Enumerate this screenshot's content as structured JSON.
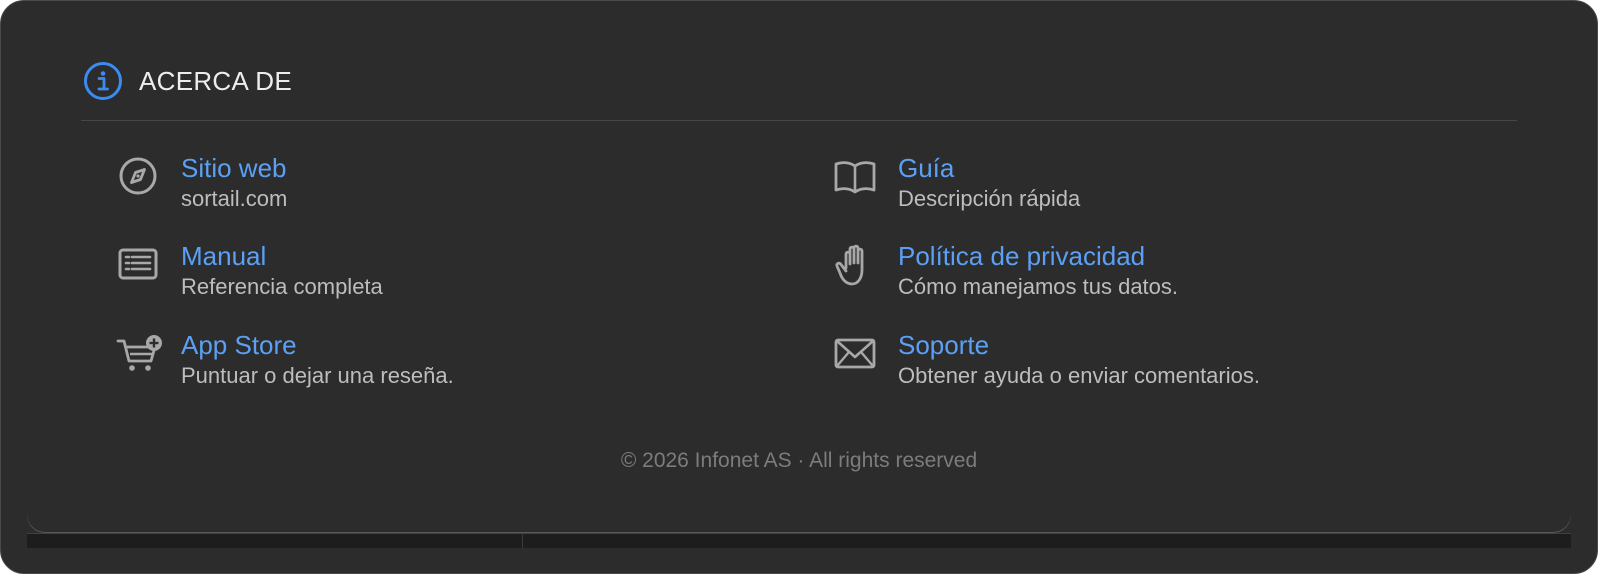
{
  "header": {
    "title": "ACERCA DE",
    "icon": "info-circle-icon"
  },
  "items": [
    {
      "icon": "compass-icon",
      "label": "Sitio web",
      "desc": "sortail.com"
    },
    {
      "icon": "newspaper-icon",
      "label": "Manual",
      "desc": "Referencia completa"
    },
    {
      "icon": "cart-add-icon",
      "label": "App Store",
      "desc": "Puntuar o dejar una reseña."
    },
    {
      "icon": "book-icon",
      "label": "Guía",
      "desc": "Descripción rápida"
    },
    {
      "icon": "hand-icon",
      "label": "Política de privacidad",
      "desc": "Cómo manejamos tus datos."
    },
    {
      "icon": "envelope-icon",
      "label": "Soporte",
      "desc": "Obtener ayuda o enviar comentarios."
    }
  ],
  "footer": {
    "copyright": "© 2026 Infonet AS · All rights reserved"
  },
  "colors": {
    "accent": "#5ba0f5",
    "background": "#2c2c2c",
    "text_primary": "#ededed",
    "text_secondary": "#bdbdbd",
    "footer_text": "#7c7c7c"
  }
}
